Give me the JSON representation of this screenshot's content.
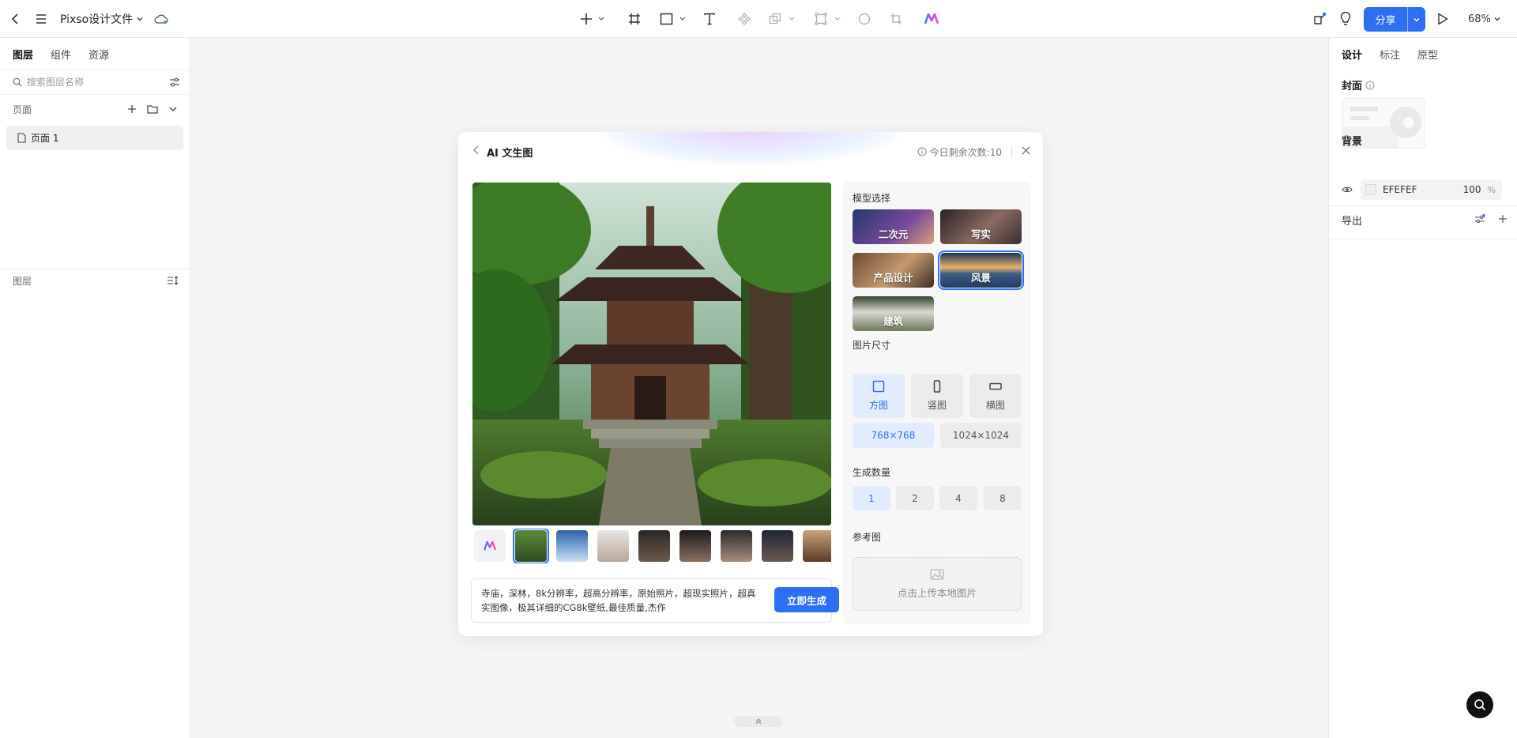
{
  "app": {
    "file_title": "Pixso设计文件",
    "share_label": "分享",
    "zoom": "68%"
  },
  "left_panel": {
    "tabs": [
      "图层",
      "组件",
      "资源"
    ],
    "search_placeholder": "搜索图层名称",
    "pages_header": "页面",
    "pages": [
      "页面 1"
    ],
    "layers_header": "图层"
  },
  "right_panel": {
    "tabs": [
      "设计",
      "标注",
      "原型"
    ],
    "cover_label": "封面",
    "background_label": "背景",
    "background_hex": "EFEFEF",
    "background_opacity": "100",
    "percent_sign": "%",
    "export_label": "导出",
    "background_color": "#EFEFEF"
  },
  "dialog": {
    "title": "AI 文生图",
    "quota": "今日剩余次数:10",
    "prompt": "寺庙，深林，8k分辨率，超高分辨率，原始照片，超现实照片，超真实图像，极其详细的CG8k壁纸,最佳质量,杰作",
    "generate_label": "立即生成",
    "model_label": "模型选择",
    "models": [
      "二次元",
      "写实",
      "产品设计",
      "风景",
      "建筑"
    ],
    "selected_model": "风景",
    "size_label": "图片尺寸",
    "sizes": [
      "方图",
      "竖图",
      "横图"
    ],
    "selected_size": "方图",
    "resolutions": [
      "768×768",
      "1024×1024"
    ],
    "selected_resolution": "768×768",
    "count_label": "生成数量",
    "counts": [
      "1",
      "2",
      "4",
      "8"
    ],
    "selected_count": "1",
    "reference_label": "参考图",
    "upload_text": "点击上传本地图片"
  },
  "colors": {
    "accent": "#2E6FF2",
    "selected_bg": "#E3ECFF"
  }
}
